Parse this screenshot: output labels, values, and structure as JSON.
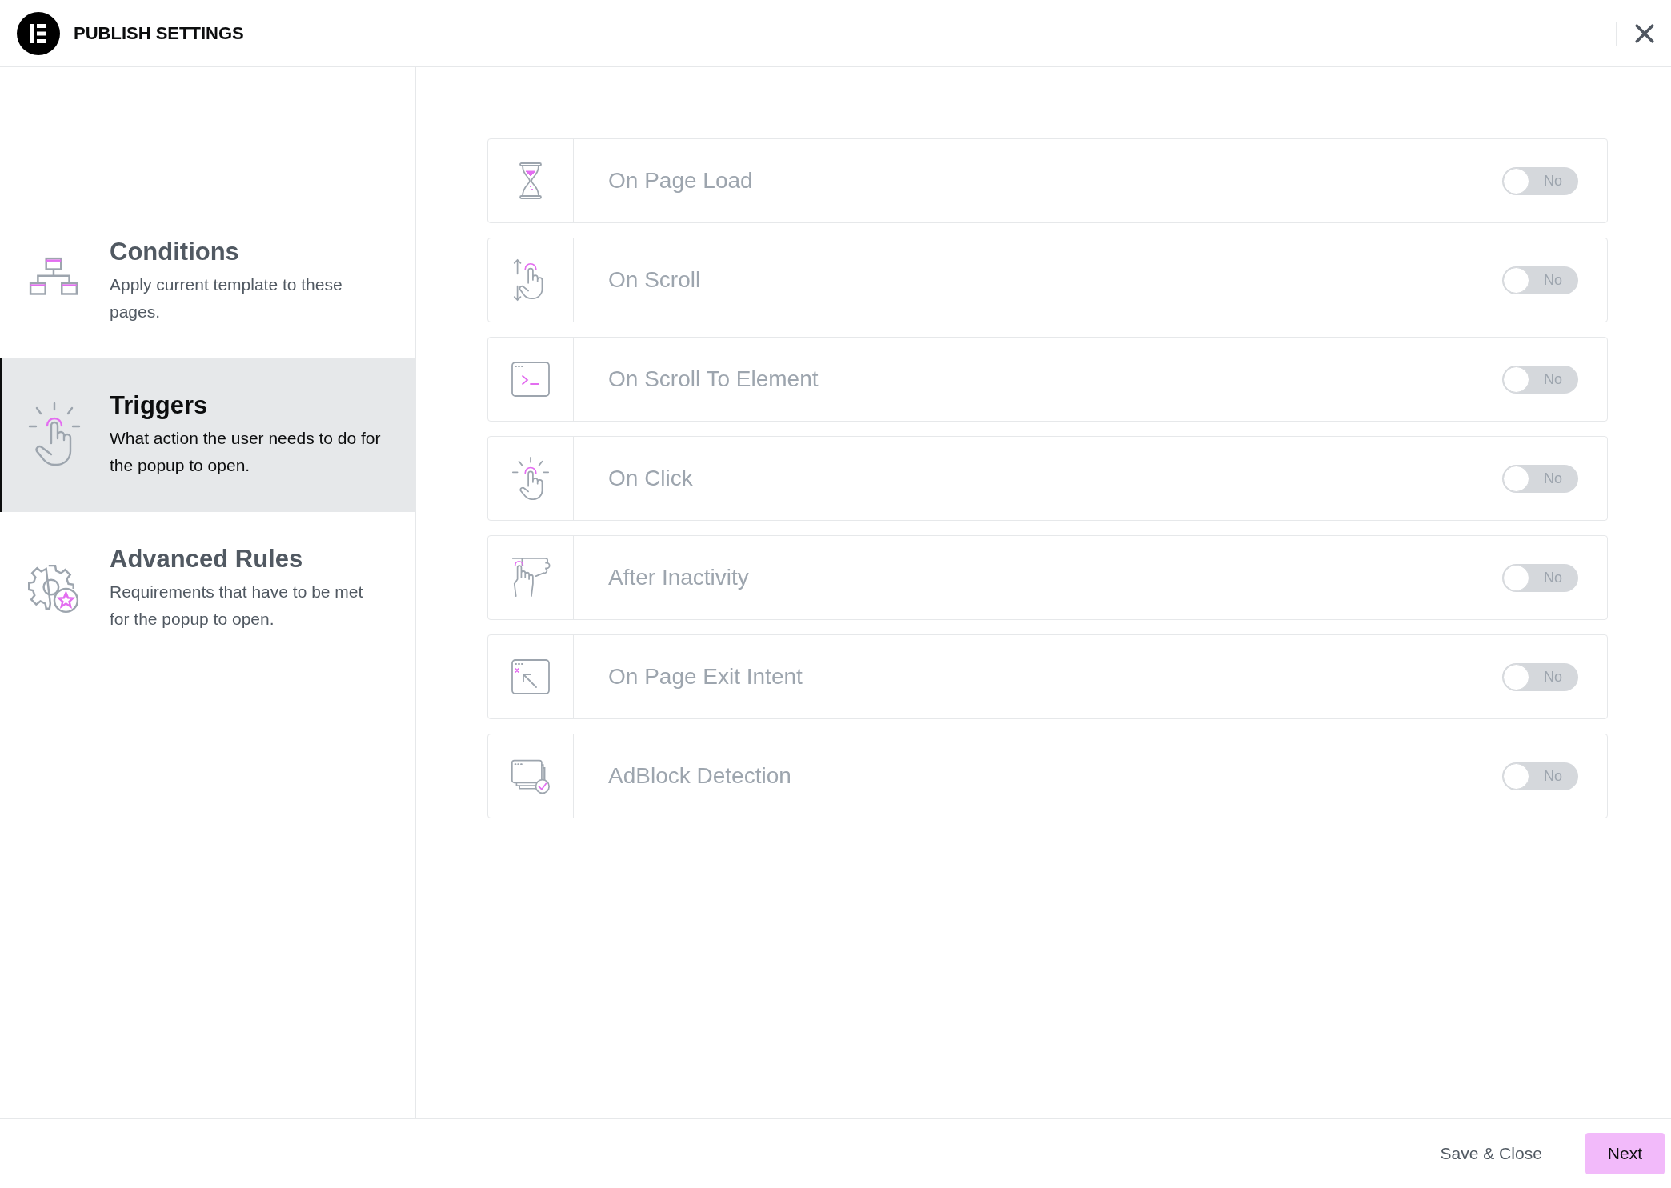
{
  "header": {
    "title": "PUBLISH SETTINGS"
  },
  "sidebar": {
    "items": [
      {
        "title": "Conditions",
        "description": "Apply current template to these pages.",
        "selected": false
      },
      {
        "title": "Triggers",
        "description": "What action the user needs to do for the popup to open.",
        "selected": true
      },
      {
        "title": "Advanced Rules",
        "description": "Requirements that have to be met for the popup to open.",
        "selected": false
      }
    ]
  },
  "triggers": [
    {
      "label": "On Page Load",
      "toggle": {
        "on": false,
        "text": "No"
      }
    },
    {
      "label": "On Scroll",
      "toggle": {
        "on": false,
        "text": "No"
      }
    },
    {
      "label": "On Scroll To Element",
      "toggle": {
        "on": false,
        "text": "No"
      }
    },
    {
      "label": "On Click",
      "toggle": {
        "on": false,
        "text": "No"
      }
    },
    {
      "label": "After Inactivity",
      "toggle": {
        "on": false,
        "text": "No"
      }
    },
    {
      "label": "On Page Exit Intent",
      "toggle": {
        "on": false,
        "text": "No"
      }
    },
    {
      "label": "AdBlock Detection",
      "toggle": {
        "on": false,
        "text": "No"
      }
    }
  ],
  "footer": {
    "buttons": [
      "Save & Close",
      "Next"
    ]
  }
}
